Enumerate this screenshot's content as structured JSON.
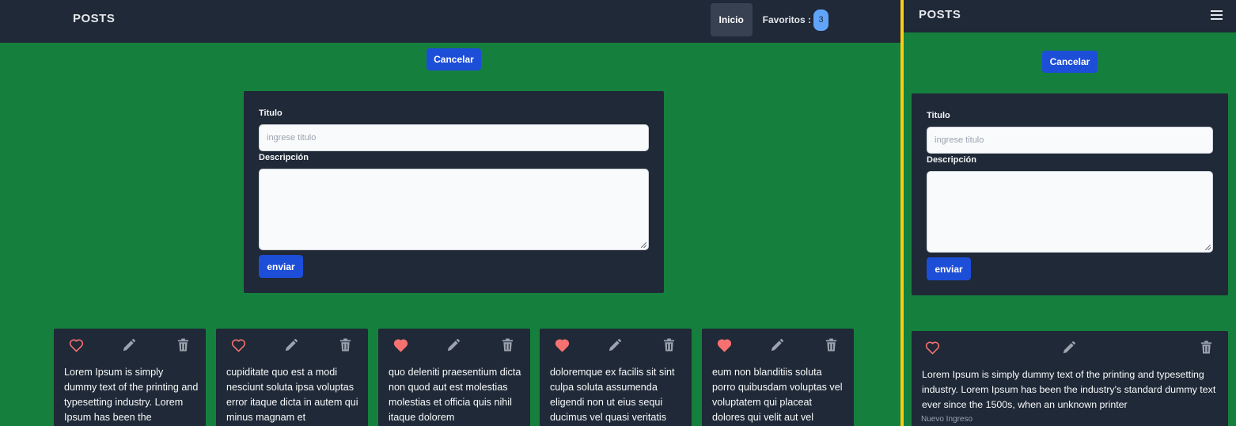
{
  "nav": {
    "logo": "POSTS",
    "home_label": "Inicio",
    "favorites_label": "Favoritos :",
    "favorites_count": "3"
  },
  "form": {
    "cancel_label": "Cancelar",
    "title_label": "Titulo",
    "title_placeholder": "ingrese titulo",
    "description_label": "Descripción",
    "submit_label": "enviar"
  },
  "posts": [
    {
      "text": "Lorem Ipsum is simply dummy text of the printing and typesetting industry. Lorem Ipsum has been the",
      "favorite": false
    },
    {
      "text": "cupiditate quo est a modi nesciunt soluta ipsa voluptas error itaque dicta in autem qui minus magnam et",
      "favorite": false
    },
    {
      "text": "quo deleniti praesentium dicta non quod aut est molestias molestias et officia quis nihil itaque dolorem",
      "favorite": true
    },
    {
      "text": "doloremque ex facilis sit sint culpa soluta assumenda eligendi non ut eius sequi ducimus vel quasi veritatis",
      "favorite": true
    },
    {
      "text": "eum non blanditiis soluta porro quibusdam voluptas vel voluptatem qui placeat dolores qui velit aut vel",
      "favorite": true
    }
  ],
  "mobile_post": {
    "text": "Lorem Ipsum is simply dummy text of the printing and typesetting industry. Lorem Ipsum has been the industry's standard dummy text ever since the 1500s, when an unknown printer",
    "status": "Nuevo Ingreso",
    "favorite": false
  },
  "colors": {
    "background": "#15803d",
    "surface": "#1f2937",
    "primary": "#1d4ed8",
    "heart": "#f87171",
    "divider": "#facc15"
  }
}
